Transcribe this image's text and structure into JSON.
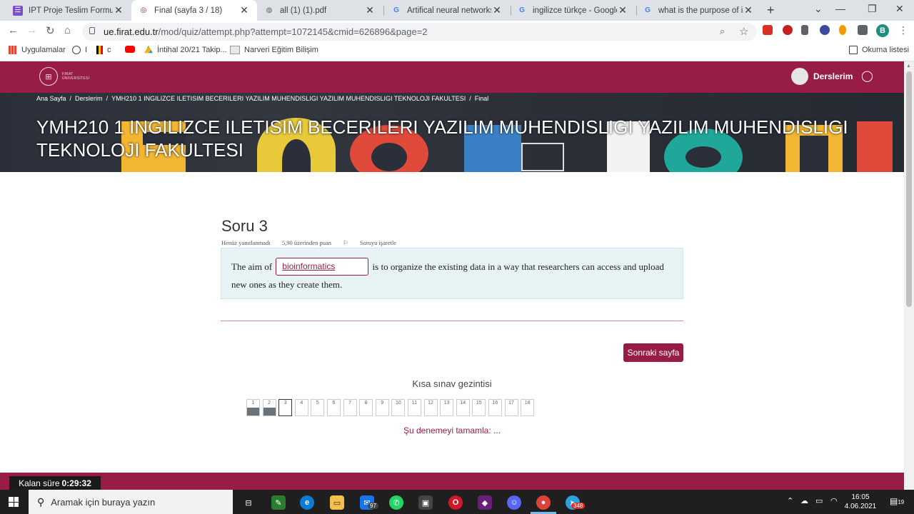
{
  "browser": {
    "tabs": [
      {
        "title": "İPT Proje Teslim Formu",
        "color": "#7b4fc9",
        "glyph": "☰"
      },
      {
        "title": "Final (sayfa 3 / 18)",
        "color": "#971d45",
        "glyph": "◎"
      },
      {
        "title": "all (1) (1).pdf",
        "color": "#5f6368",
        "glyph": "◍"
      },
      {
        "title": "Artifical neural networks co",
        "color": "#4285f4",
        "glyph": "G"
      },
      {
        "title": "ingilizce türkçe - Google Se",
        "color": "#4285f4",
        "glyph": "G"
      },
      {
        "title": "what is the purpose of is to",
        "color": "#4285f4",
        "glyph": "G"
      }
    ],
    "url_host": "ue.firat.edu.tr",
    "url_path": "/mod/quiz/attempt.php?attempt=1072145&cmid=626896&page=2",
    "profile_initial": "B",
    "bookmarks": [
      {
        "label": "Uygulamalar"
      },
      {
        "label": "I"
      },
      {
        "label": "c"
      },
      {
        "label": ""
      },
      {
        "label": "İntihal 20/21 Takip..."
      },
      {
        "label": "Narveri Eğitim Bilişim"
      }
    ],
    "reading_list": "Okuma listesi"
  },
  "site": {
    "logo_text_1": "FIRAT",
    "logo_text_2": "ÜNİVERSİTESİ",
    "user_menu": "Derslerim"
  },
  "breadcrumb": [
    "Ana Sayfa",
    "/",
    "Derslerim",
    "/",
    "YMH210 1 INGILIZCE ILETISIM BECERILERI YAZILIM MUHENDISLIGI YAZILIM MUHENDISLIGI TEKNOLOJI FAKULTESI",
    "/",
    "Final"
  ],
  "course_title": "YMH210 1 INGILIZCE ILETISIM BECERILERI YAZILIM MUHENDISLIGI YAZILIM MUHENDISLIGI TEKNOLOJI FAKULTESI",
  "question": {
    "title": "Soru 3",
    "status": "Henüz yanıtlanmadı",
    "points": "5,90 üzerinden puan",
    "flag": "Soruyu işaretle",
    "text_before": "The aim of",
    "answer_value": "bioinformatics",
    "text_after": "is to organize the existing data in a way that researchers can access and upload new ones as they create them."
  },
  "next_button": "Sonraki sayfa",
  "quiz_nav": {
    "title": "Kısa sınav gezintisi",
    "current": 3,
    "items": [
      {
        "n": "1",
        "answered": true
      },
      {
        "n": "2",
        "answered": true
      },
      {
        "n": "3",
        "answered": false
      },
      {
        "n": "4",
        "answered": false
      },
      {
        "n": "5",
        "answered": false
      },
      {
        "n": "6",
        "answered": false
      },
      {
        "n": "7",
        "answered": false
      },
      {
        "n": "8",
        "answered": false
      },
      {
        "n": "9",
        "answered": false
      },
      {
        "n": "10",
        "answered": false
      },
      {
        "n": "11",
        "answered": false
      },
      {
        "n": "12",
        "answered": false
      },
      {
        "n": "13",
        "answered": false
      },
      {
        "n": "14",
        "answered": false
      },
      {
        "n": "15",
        "answered": false
      },
      {
        "n": "16",
        "answered": false
      },
      {
        "n": "17",
        "answered": false
      },
      {
        "n": "18",
        "answered": false
      }
    ],
    "finish_link": "Şu denemeyi tamamla: ..."
  },
  "timer": {
    "label": "Kalan süre",
    "value": "0:29:32"
  },
  "taskbar": {
    "search_placeholder": "Aramak için buraya yazın",
    "mail_badge": "97",
    "telegram_badge": "348",
    "time": "16:05",
    "date": "4.06.2021",
    "notifications": "19"
  }
}
